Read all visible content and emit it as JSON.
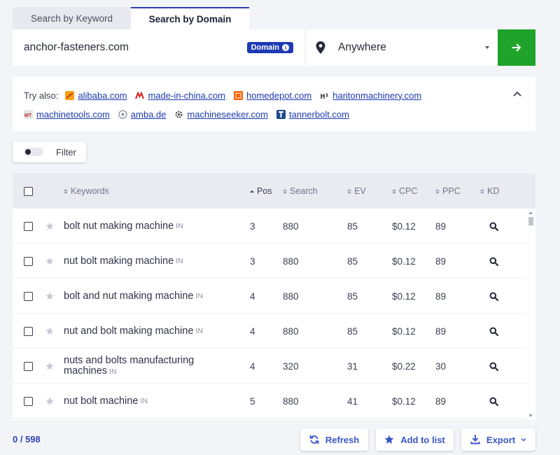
{
  "tabs": [
    {
      "label": "Search by Keyword",
      "active": false
    },
    {
      "label": "Search by Domain",
      "active": true
    }
  ],
  "search": {
    "domain_value": "anchor-fasteners.com",
    "domain_badge": "Domain",
    "location_value": "Anywhere"
  },
  "try_also": {
    "label": "Try also:",
    "links": [
      {
        "text": "alibaba.com",
        "icon": "alibaba-favicon"
      },
      {
        "text": "made-in-china.com",
        "icon": "made-in-china-favicon"
      },
      {
        "text": "homedepot.com",
        "icon": "homedepot-favicon"
      },
      {
        "text": "haritonmachinery.com",
        "icon": "hariton-favicon"
      },
      {
        "text": "machinetools.com",
        "icon": "machinetools-favicon"
      },
      {
        "text": "amba.de",
        "icon": "amba-favicon"
      },
      {
        "text": "machineseeker.com",
        "icon": "machineseeker-favicon"
      },
      {
        "text": "tannerbolt.com",
        "icon": "tannerbolt-favicon"
      }
    ]
  },
  "filter": {
    "label": "Filter",
    "enabled": false
  },
  "table": {
    "headers": {
      "keywords": "Keywords",
      "pos": "Pos",
      "search": "Search",
      "ev": "EV",
      "cpc": "CPC",
      "ppc": "PPC",
      "kd": "KD"
    },
    "rows": [
      {
        "keyword": "bolt nut making machine",
        "code": "IN",
        "pos": "3",
        "search": "880",
        "ev": "85",
        "cpc": "$0.12",
        "ppc": "89"
      },
      {
        "keyword": "nut bolt making machine",
        "code": "IN",
        "pos": "3",
        "search": "880",
        "ev": "85",
        "cpc": "$0.12",
        "ppc": "89"
      },
      {
        "keyword": "bolt and nut making machine",
        "code": "IN",
        "pos": "4",
        "search": "880",
        "ev": "85",
        "cpc": "$0.12",
        "ppc": "89"
      },
      {
        "keyword": "nut and bolt making machine",
        "code": "IN",
        "pos": "4",
        "search": "880",
        "ev": "85",
        "cpc": "$0.12",
        "ppc": "89"
      },
      {
        "keyword_line1": "nuts and bolts manufacturing",
        "keyword_line2": "machines",
        "code": "IN",
        "pos": "4",
        "search": "320",
        "ev": "31",
        "cpc": "$0.22",
        "ppc": "30"
      },
      {
        "keyword": "nut bolt machine",
        "code": "IN",
        "pos": "5",
        "search": "880",
        "ev": "41",
        "cpc": "$0.12",
        "ppc": "89"
      }
    ]
  },
  "footer": {
    "counter": "0 / 598",
    "refresh_label": "Refresh",
    "add_to_list_label": "Add to list",
    "export_label": "Export"
  },
  "colors": {
    "accent": "#1e3ab5",
    "go_button": "#1fa32b",
    "link": "#1d3ab0"
  }
}
